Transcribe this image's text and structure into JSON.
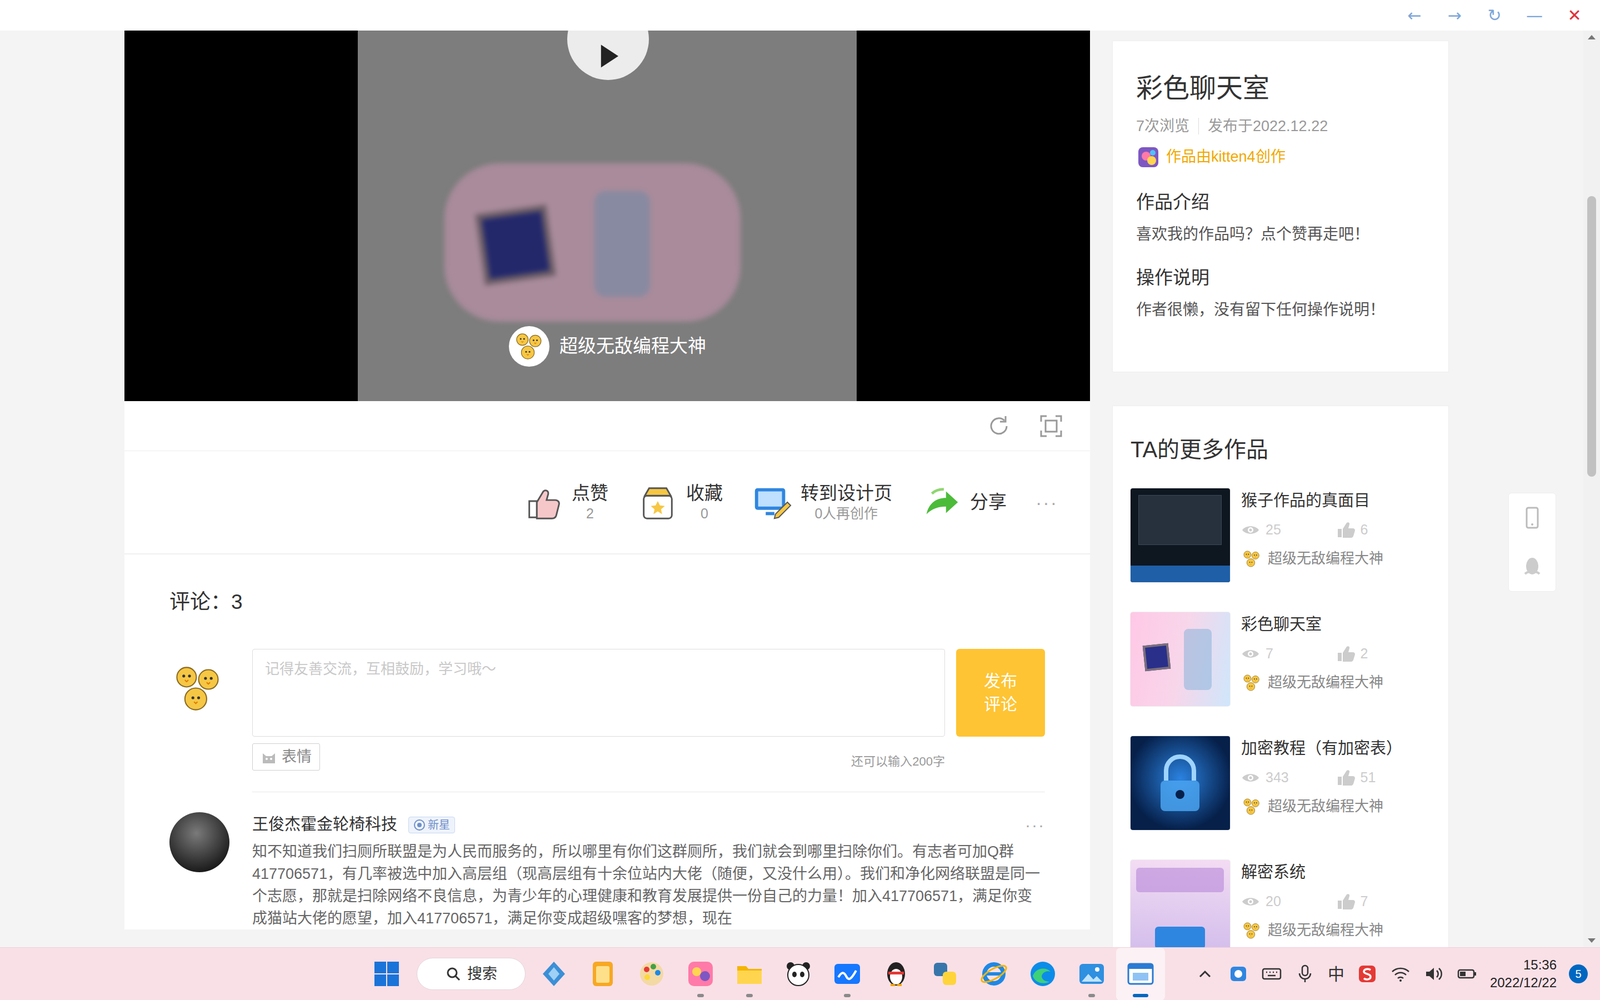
{
  "window": {
    "controls": [
      {
        "label": "←",
        "kind": "nav"
      },
      {
        "label": "→",
        "kind": "nav"
      },
      {
        "label": "↻",
        "kind": "nav"
      },
      {
        "label": "—",
        "kind": "nav"
      },
      {
        "label": "✕",
        "kind": "close"
      }
    ]
  },
  "player": {
    "author": "超级无敌编程大神"
  },
  "actions": {
    "items": [
      {
        "label": "点赞",
        "count": "2",
        "kind": "like"
      },
      {
        "label": "收藏",
        "count": "0",
        "kind": "favorite"
      },
      {
        "label": "转到设计页",
        "count": "0人再创作",
        "kind": "design"
      },
      {
        "label": "分享",
        "kind": "share"
      }
    ],
    "more": "···"
  },
  "comments": {
    "title": "评论：3",
    "placeholder": "记得友善交流，互相鼓励，学习哦～",
    "submit": "发布评论",
    "emoji": "表情",
    "remaining": "还可以输入200字",
    "items": [
      {
        "author": "王俊杰霍金轮椅科技",
        "badge": "新星",
        "menu": "···",
        "text": "知不知道我们扫厕所联盟是为人民而服务的，所以哪里有你们这群厕所，我们就会到哪里扫除你们。有志者可加Q群417706571，有几率被选中加入高层组（现高层组有十余位站内大佬（随便，又没什么用）。我们和净化网络联盟是同一个志愿，那就是扫除网络不良信息，为青少年的心理健康和教育发展提供一份自己的力量！加入417706571，满足你变成猫站大佬的愿望，加入417706571，满足你变成超级嘿客的梦想，现在"
      }
    ]
  },
  "work": {
    "title": "彩色聊天室",
    "views": "7次浏览",
    "published": "发布于2022.12.22",
    "creator": "作品由kitten4创作",
    "sections": [
      {
        "heading": "作品介绍",
        "text": "喜欢我的作品吗？点个赞再走吧！"
      },
      {
        "heading": "操作说明",
        "text": "作者很懒，没有留下任何操作说明！"
      }
    ]
  },
  "more_works": {
    "title": "TA的更多作品",
    "items": [
      {
        "title": "猴子作品的真面目",
        "views": "25",
        "likes": "6",
        "author": "超级无敌编程大神",
        "kind": "dark"
      },
      {
        "title": "彩色聊天室",
        "views": "7",
        "likes": "2",
        "author": "超级无敌编程大神",
        "kind": "pink"
      },
      {
        "title": "加密教程（有加密表）",
        "views": "343",
        "likes": "51",
        "author": "超级无敌编程大神",
        "kind": "lock"
      },
      {
        "title": "解密系统",
        "views": "20",
        "likes": "7",
        "author": "超级无敌编程大神",
        "kind": "purple"
      }
    ]
  },
  "scrollbar": {
    "level": 0.25
  },
  "taskbar": {
    "search": "搜索",
    "apps": [
      {
        "kind": "start",
        "running": false,
        "selected": false
      },
      {
        "kind": "widgets",
        "running": false,
        "selected": false
      },
      {
        "kind": "notes",
        "running": false,
        "selected": false
      },
      {
        "kind": "paint",
        "running": false,
        "selected": false
      },
      {
        "kind": "kitten",
        "running": true,
        "selected": false
      },
      {
        "kind": "folder",
        "running": true,
        "selected": false
      },
      {
        "kind": "panda",
        "running": false,
        "selected": false
      },
      {
        "kind": "board",
        "running": true,
        "selected": false
      },
      {
        "kind": "qq",
        "running": false,
        "selected": false
      },
      {
        "kind": "python",
        "running": false,
        "selected": false
      },
      {
        "kind": "ie",
        "running": false,
        "selected": false
      },
      {
        "kind": "edge",
        "running": false,
        "selected": false
      },
      {
        "kind": "photos",
        "running": true,
        "selected": false
      },
      {
        "kind": "explorer",
        "running": true,
        "selected": true
      }
    ],
    "tray": {
      "ime": "中",
      "time": "15:36",
      "date": "2022/12/22",
      "notifications": "5"
    }
  }
}
